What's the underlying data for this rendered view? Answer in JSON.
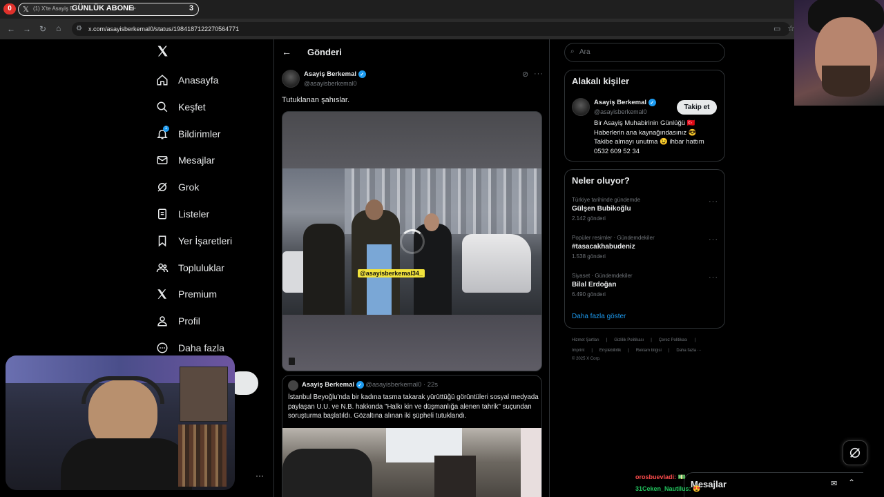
{
  "browser": {
    "tab_count_badge": "0",
    "tab_title": "(1) X'te Asayiş B...",
    "overlay_label": "GÜNLÜK ABONE",
    "new_tab": "+",
    "tab_counter": "3",
    "url": "x.com/asayisberkemal0/status/1984187122270564771"
  },
  "nav": {
    "items": [
      {
        "label": "Anasayfa",
        "icon": "home-icon"
      },
      {
        "label": "Keşfet",
        "icon": "search-icon"
      },
      {
        "label": "Bildirimler",
        "icon": "bell-icon",
        "badge": "1"
      },
      {
        "label": "Mesajlar",
        "icon": "mail-icon"
      },
      {
        "label": "Grok",
        "icon": "grok-icon"
      },
      {
        "label": "Listeler",
        "icon": "list-icon"
      },
      {
        "label": "Yer İşaretleri",
        "icon": "bookmark-icon"
      },
      {
        "label": "Topluluklar",
        "icon": "people-icon"
      },
      {
        "label": "Premium",
        "icon": "x-logo-icon"
      },
      {
        "label": "Profil",
        "icon": "person-icon"
      },
      {
        "label": "Daha fazla",
        "icon": "more-circle-icon"
      }
    ],
    "more_dots": "···"
  },
  "post": {
    "header_title": "Gönderi",
    "author_name": "Asayiş Berkemal",
    "author_handle": "@asayisberkemal0",
    "text": "Tutuklanan şahıslar.",
    "video_watermark": "@asayisberkemal34_",
    "quoted": {
      "author_name": "Asayiş Berkemal",
      "author_handle": "@asayisberkemal0",
      "time": "· 22s",
      "text": "İstanbul Beyoğlu'nda bir kadına tasma takarak yürüttüğü görüntüleri sosyal medyada paylaşan U.U. ve N.B. hakkında \"Halkı kin ve düşmanlığa alenen tahrik\" suçundan soruşturma başlatıldı. Gözaltına alınan iki şüpheli tutuklandı."
    }
  },
  "sidebar": {
    "search_placeholder": "Ara",
    "related": {
      "title": "Alakalı kişiler",
      "name": "Asayiş Berkemal",
      "handle": "@asayisberkemal0",
      "follow_button": "Takip et",
      "bio_lines": [
        "Bir Asayiş Muhabirinin Günlüğü 🇹🇷",
        "Haberlerin ana kaynağındasınız 😎",
        "Takibe almayı unutma 😉 ihbar hattım",
        "0532 609 52 34"
      ]
    },
    "trends": {
      "title": "Neler oluyor?",
      "items": [
        {
          "meta": "Türkiye tarihinde gündemde",
          "title": "Gülşen Bubikoğlu",
          "count": "2.142 gönderi"
        },
        {
          "meta": "Popüler resimler · Gündemdekiler",
          "title": "#tasacakhabudeniz",
          "count": "1.538 gönderi"
        },
        {
          "meta": "Siyaset · Gündemdekiler",
          "title": "Bilal Erdoğan",
          "count": "6.490 gönderi"
        }
      ],
      "show_more": "Daha fazla göster"
    },
    "footer": {
      "line1": [
        "Hizmet Şartları",
        "Gizlilik Politikası",
        "Çerez Politikası"
      ],
      "line2": [
        "Imprint",
        "Erişilebilirlik",
        "Reklam bilgisi",
        "Daha fazla ···"
      ],
      "line3": "© 2025 X Corp."
    }
  },
  "messages_bar": {
    "label": "Mesajlar"
  },
  "stream_chat": {
    "lines": [
      {
        "user": "orosbuevladi:",
        "msg": "💵"
      },
      {
        "user": "31Ceken_Nautilus:",
        "msg": "😍"
      }
    ]
  },
  "colors": {
    "accent": "#1d9bf0",
    "bg": "#000000",
    "border": "#2f3336",
    "muted": "#71767b",
    "chat_user1": "#ff4d4d",
    "chat_user2": "#22c55e"
  }
}
